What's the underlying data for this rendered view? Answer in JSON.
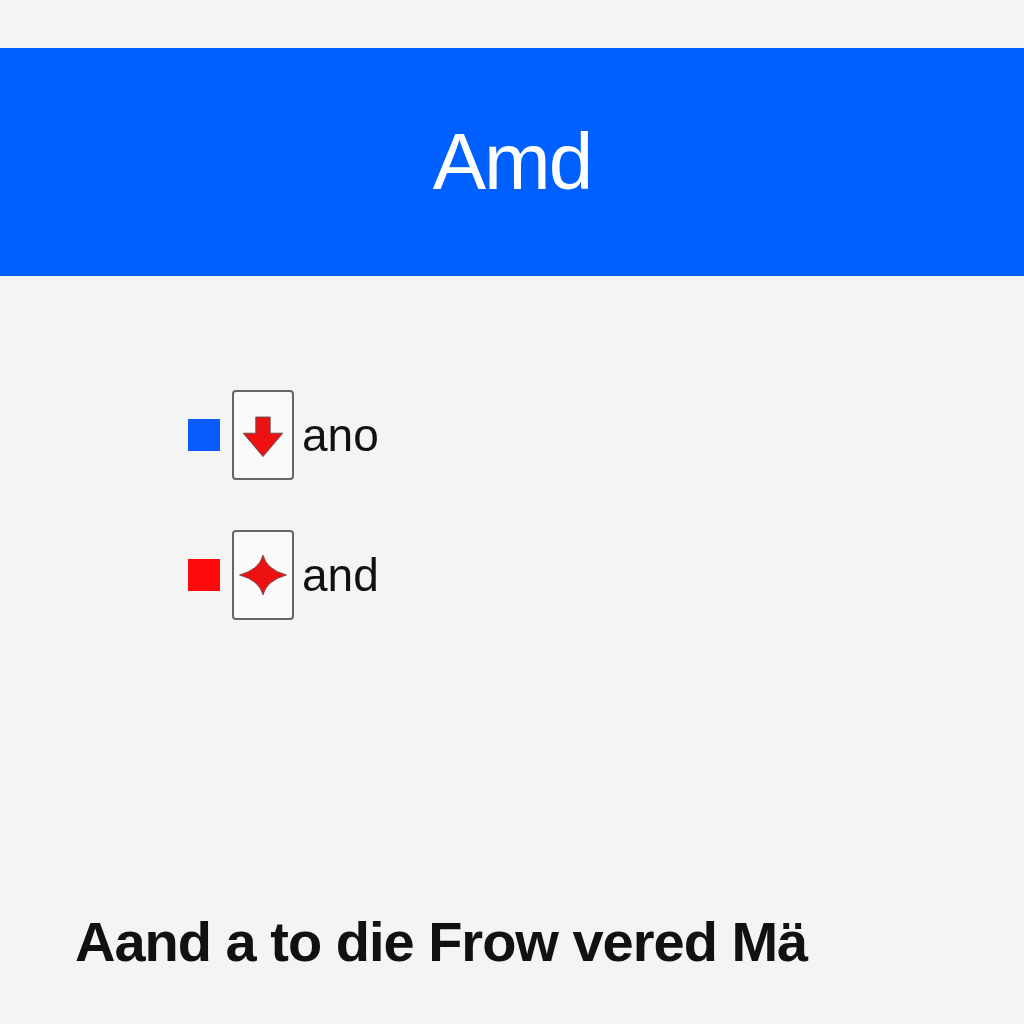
{
  "header": {
    "title": "Amd"
  },
  "items": [
    {
      "color": "#0a5cff",
      "kind": "arrow",
      "label": "ano"
    },
    {
      "color": "#ff0a0a",
      "kind": "star",
      "label": "and"
    }
  ],
  "caption": "Aand a to die Frow vered Mä"
}
